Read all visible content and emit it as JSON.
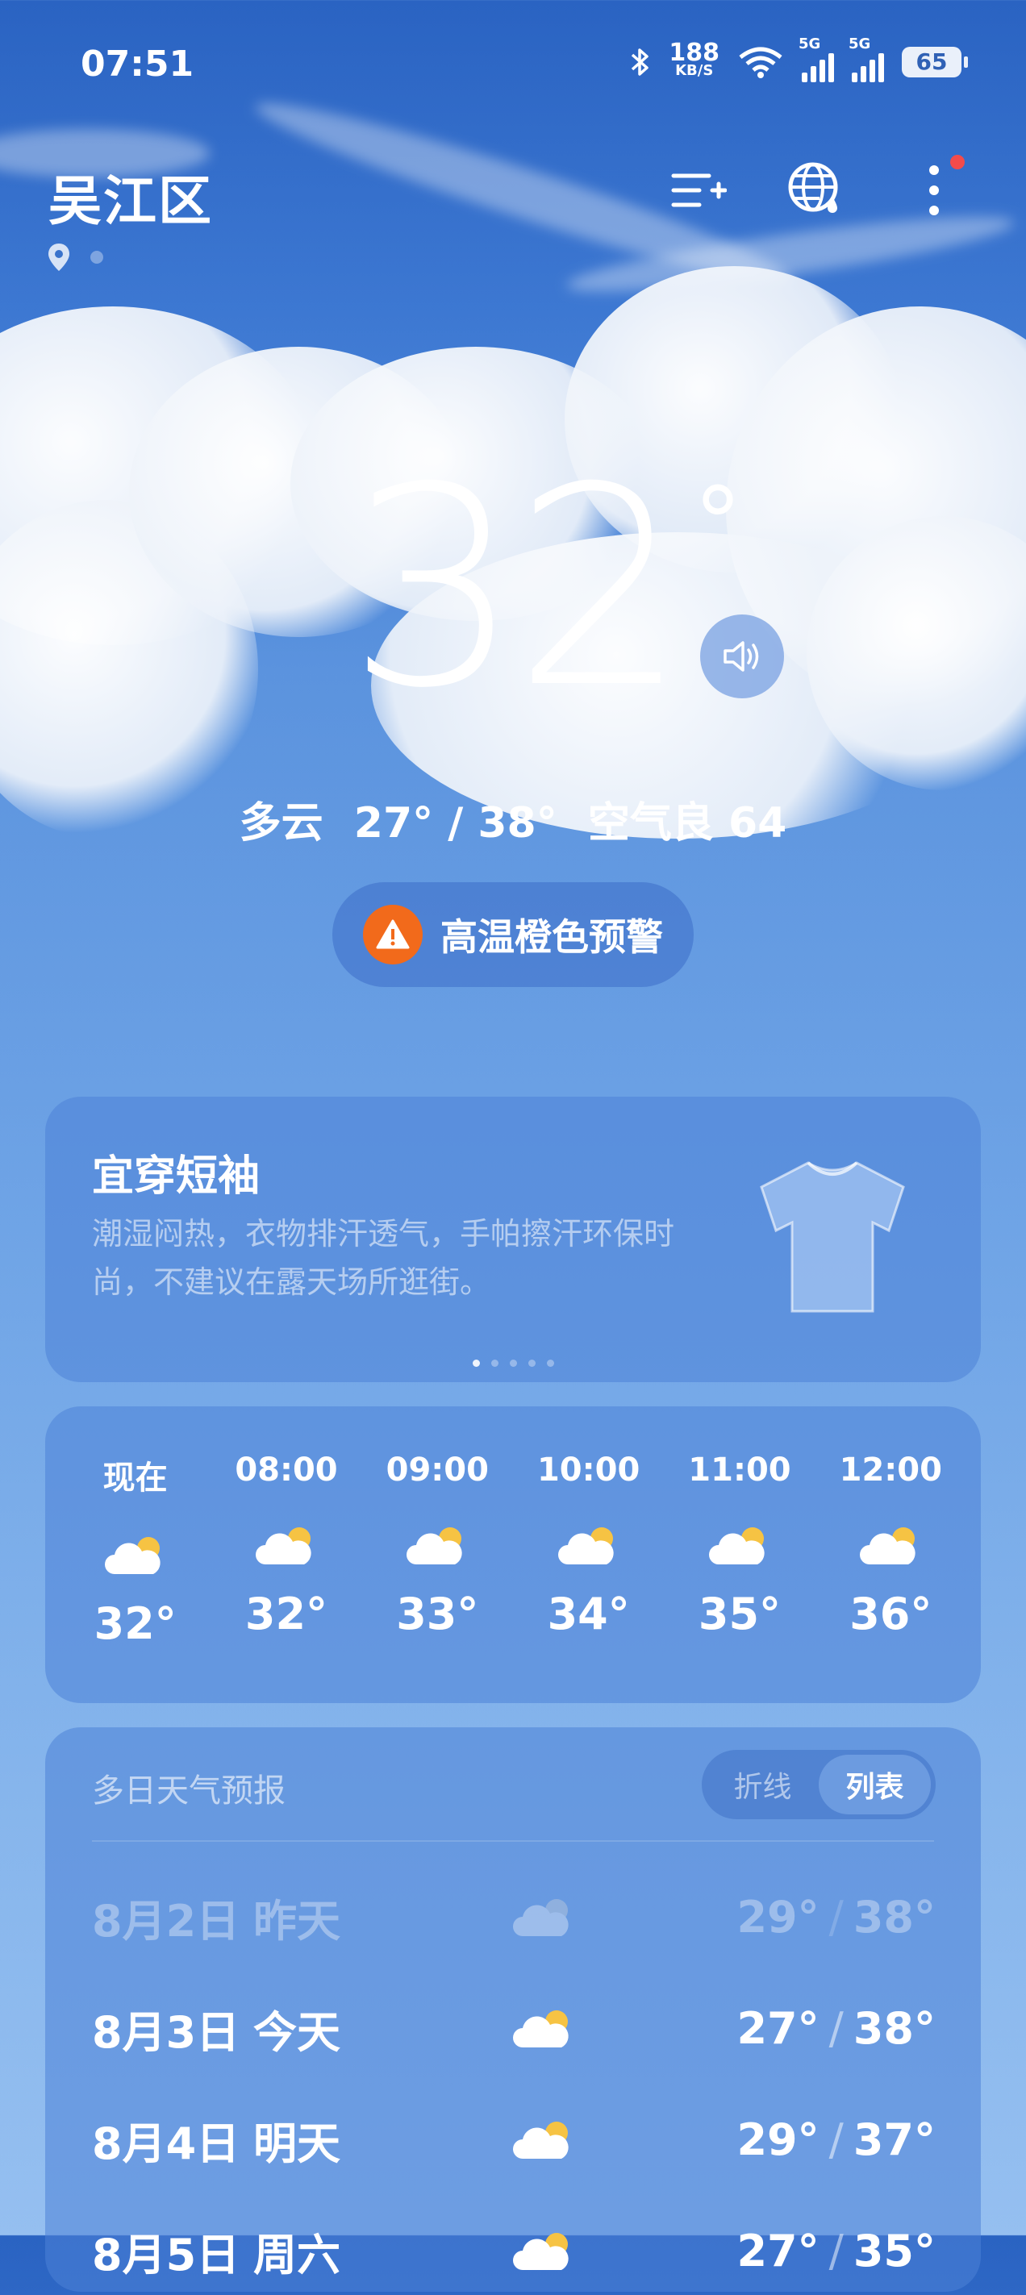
{
  "status_bar": {
    "time": "07:51",
    "net_speed_value": "188",
    "net_speed_unit": "KB/S",
    "sim1": "5G",
    "sim2": "5G",
    "battery": "65"
  },
  "header": {
    "city": "吴江区",
    "icons": [
      "city-list-add-icon",
      "globe-rain-icon",
      "more-vertical-icon"
    ]
  },
  "current": {
    "temperature": "32",
    "degree_symbol": "°",
    "condition": "多云",
    "range": "27° / 38°",
    "air_quality": "空气良 64",
    "alert_text": "高温橙色预警"
  },
  "clothing_card": {
    "title": "宜穿短袖",
    "description": "潮湿闷热，衣物排汗透气，手帕擦汗环保时尚，不建议在露天场所逛街。",
    "pager_count": 5,
    "pager_active": 0
  },
  "hourly": [
    {
      "time": "现在",
      "temp": "32°",
      "icon": "partly-cloudy-icon"
    },
    {
      "time": "08:00",
      "temp": "32°",
      "icon": "partly-cloudy-icon"
    },
    {
      "time": "09:00",
      "temp": "33°",
      "icon": "partly-cloudy-icon"
    },
    {
      "time": "10:00",
      "temp": "34°",
      "icon": "partly-cloudy-icon"
    },
    {
      "time": "11:00",
      "temp": "35°",
      "icon": "partly-cloudy-icon"
    },
    {
      "time": "12:00",
      "temp": "36°",
      "icon": "partly-cloudy-icon"
    }
  ],
  "forecast": {
    "title": "多日天气预报",
    "toggle_line": "折线",
    "toggle_list": "列表",
    "days": [
      {
        "date": "8月2日",
        "relative": "昨天",
        "low": "29°",
        "high": "38°",
        "icon": "partly-cloudy-icon"
      },
      {
        "date": "8月3日",
        "relative": "今天",
        "low": "27°",
        "high": "38°",
        "icon": "partly-cloudy-icon"
      },
      {
        "date": "8月4日",
        "relative": "明天",
        "low": "29°",
        "high": "37°",
        "icon": "partly-cloudy-icon"
      },
      {
        "date": "8月5日",
        "relative": "周六",
        "low": "27°",
        "high": "35°",
        "icon": "partly-cloudy-icon"
      }
    ],
    "separator": "/"
  }
}
